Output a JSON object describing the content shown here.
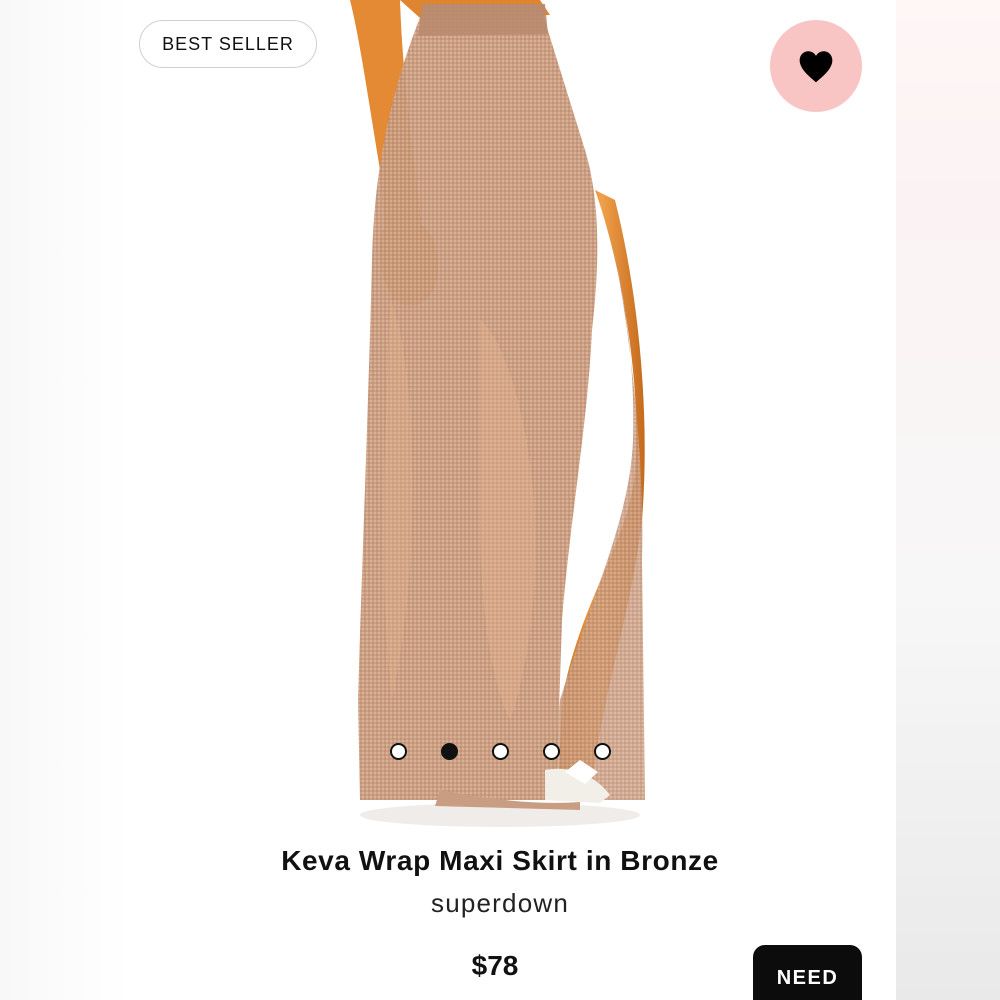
{
  "badge": {
    "label": "BEST SELLER"
  },
  "wishlist": {
    "icon": "heart-icon",
    "background": "#f9c4c4",
    "icon_color": "#000000"
  },
  "carousel": {
    "slide_count": 5,
    "active_index": 1
  },
  "product": {
    "title": "Keva Wrap Maxi Skirt in Bronze",
    "brand": "superdown",
    "price": "$78"
  },
  "actions": {
    "need_label": "NEED"
  },
  "colors": {
    "skirt": "#c99a7c",
    "skin": "#e59139",
    "button": "#0c0c0c"
  }
}
